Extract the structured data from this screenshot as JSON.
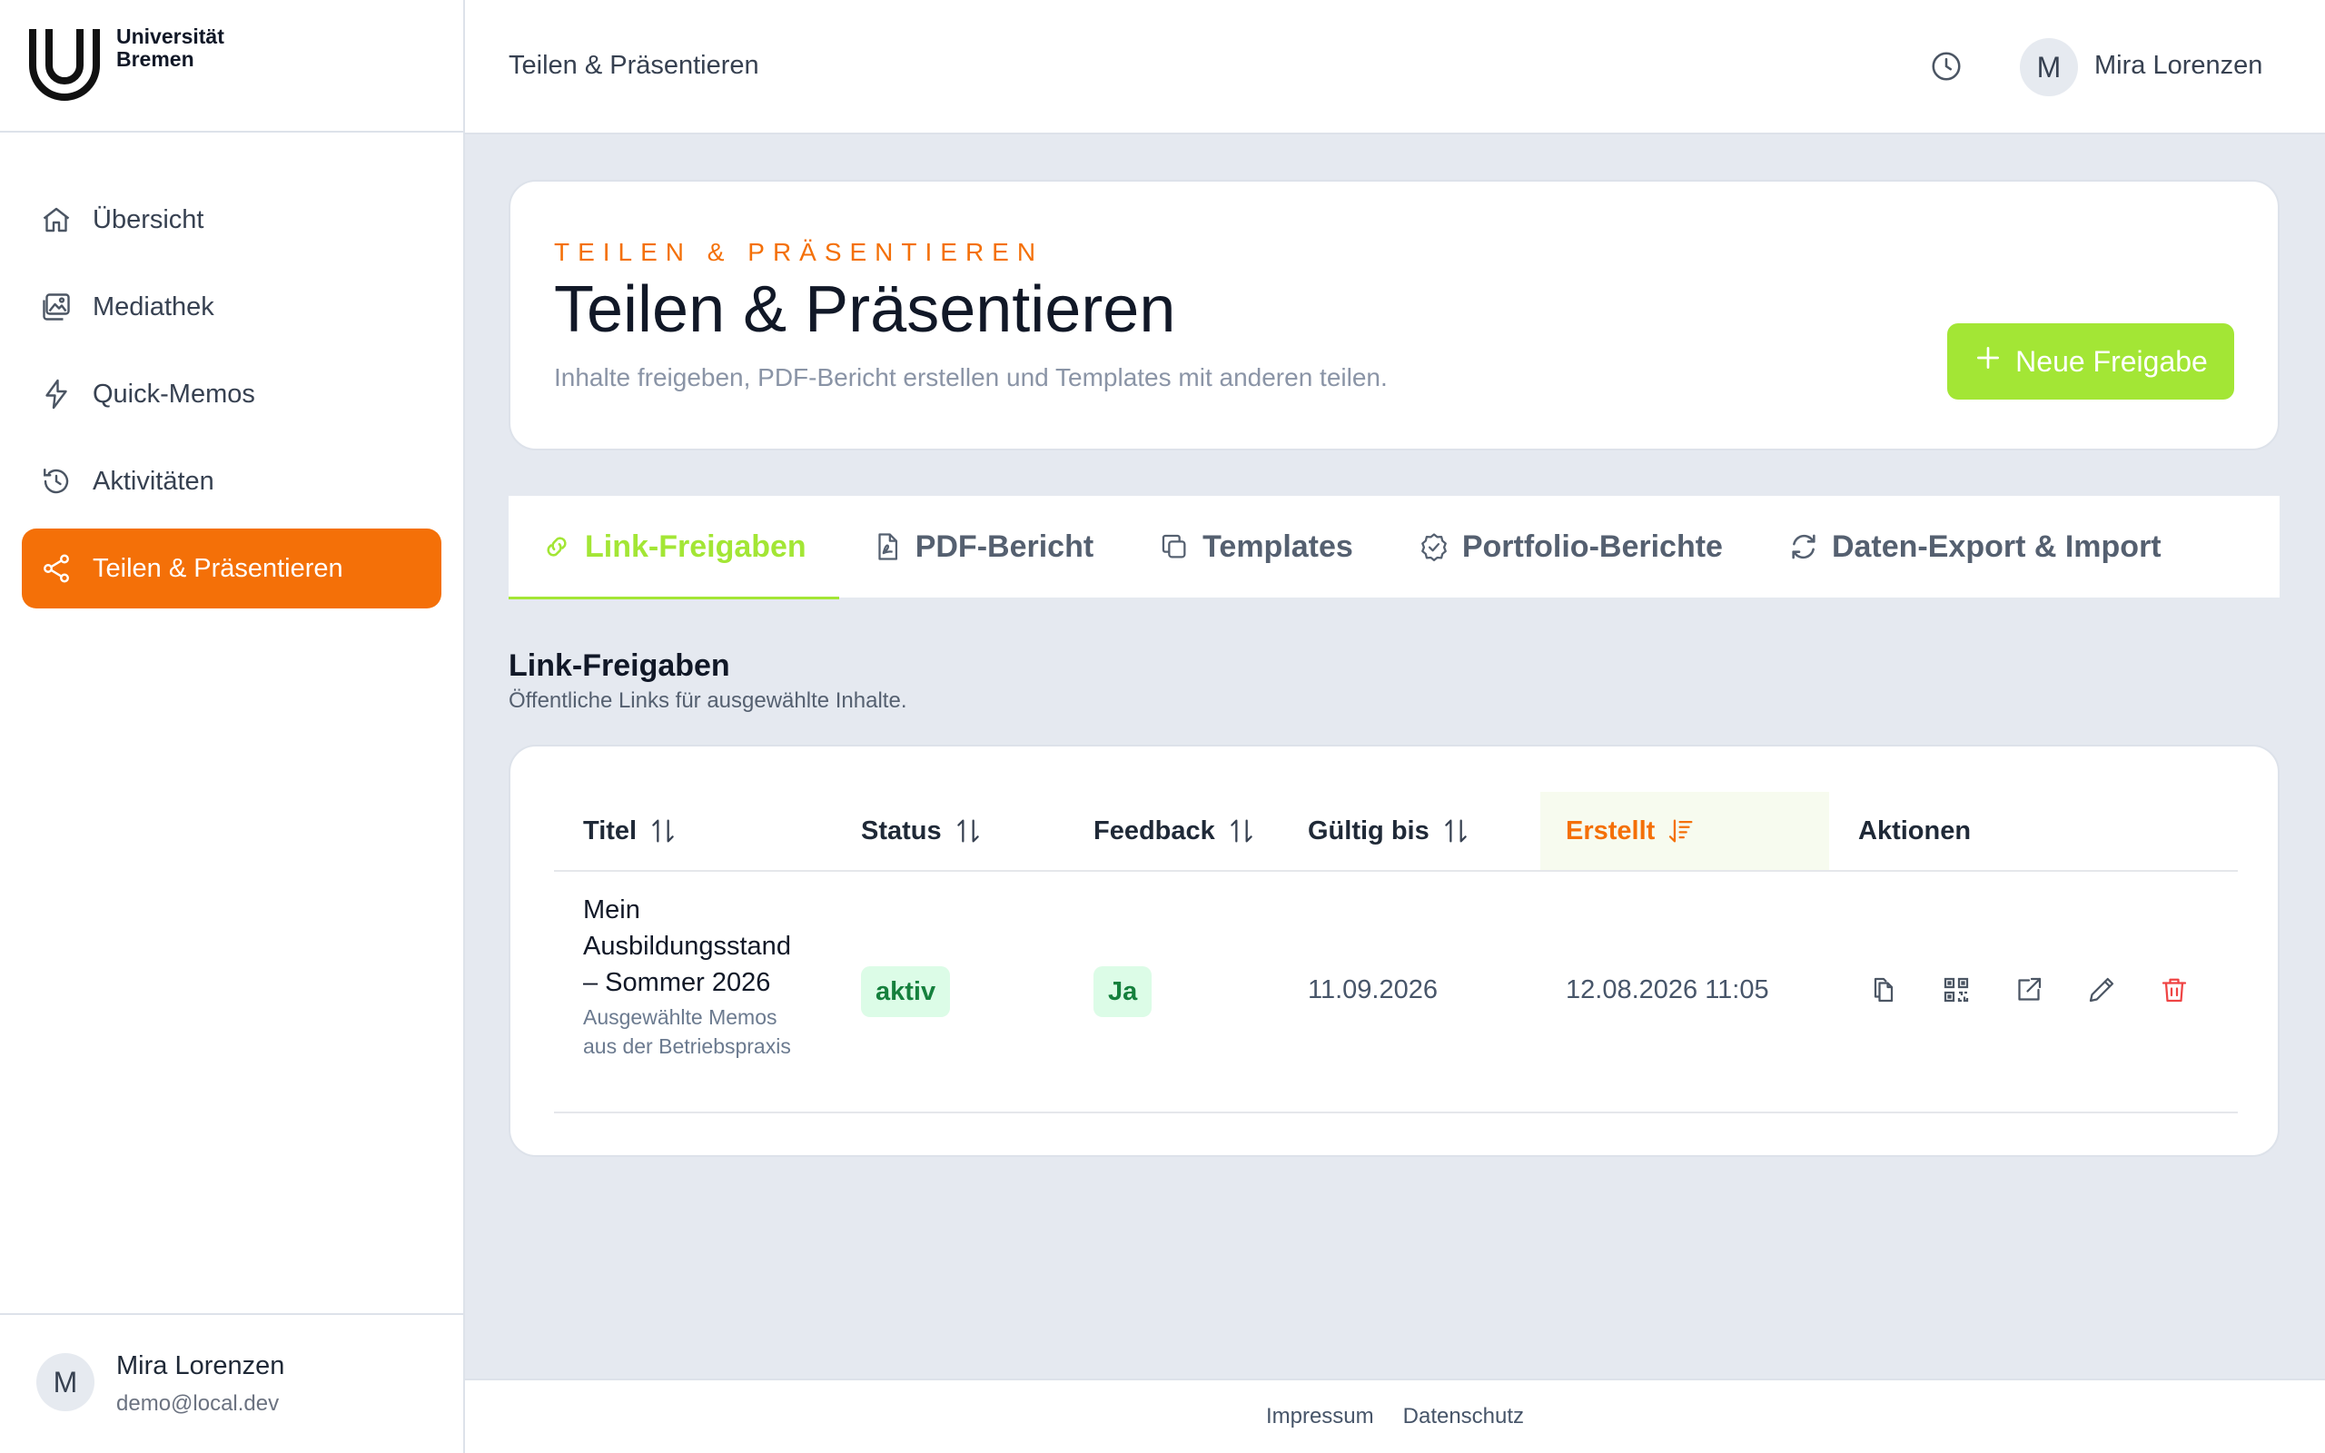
{
  "brand": {
    "line1": "Universität",
    "line2": "Bremen"
  },
  "sidebar": {
    "items": [
      {
        "label": "Übersicht",
        "icon": "home-icon"
      },
      {
        "label": "Mediathek",
        "icon": "images-icon"
      },
      {
        "label": "Quick-Memos",
        "icon": "lightning-icon"
      },
      {
        "label": "Aktivitäten",
        "icon": "history-icon"
      },
      {
        "label": "Teilen & Präsentieren",
        "icon": "share-icon",
        "active": true
      }
    ],
    "user": {
      "initial": "M",
      "name": "Mira Lorenzen",
      "email": "demo@local.dev"
    }
  },
  "header": {
    "title": "Teilen & Präsentieren",
    "user": {
      "initial": "M",
      "name": "Mira Lorenzen"
    }
  },
  "hero": {
    "eyebrow": "TEILEN & PRÄSENTIEREN",
    "title": "Teilen & Präsentieren",
    "subtitle": "Inhalte freigeben, PDF-Bericht erstellen und Templates mit anderen teilen.",
    "button": "Neue Freigabe"
  },
  "tabs": [
    {
      "label": "Link-Freigaben",
      "icon": "link-icon",
      "active": true
    },
    {
      "label": "PDF-Bericht",
      "icon": "pdf-file-icon"
    },
    {
      "label": "Templates",
      "icon": "copy-icon"
    },
    {
      "label": "Portfolio-Berichte",
      "icon": "check-badge-icon"
    },
    {
      "label": "Daten-Export & Import",
      "icon": "refresh-icon"
    }
  ],
  "section": {
    "title": "Link-Freigaben",
    "subtitle": "Öffentliche Links für ausgewählte Inhalte."
  },
  "table": {
    "columns": [
      "Titel",
      "Status",
      "Feedback",
      "Gültig bis",
      "Erstellt",
      "Aktionen"
    ],
    "sorted_column": "Erstellt",
    "rows": [
      {
        "title": "Mein Ausbildungsstand – Sommer 2026",
        "description": "Ausgewählte Memos aus der Betriebspraxis",
        "status": "aktiv",
        "feedback": "Ja",
        "valid_until": "11.09.2026",
        "created": "12.08.2026 11:05",
        "actions": [
          "copy-icon",
          "qr-code-icon",
          "external-link-icon",
          "edit-icon",
          "delete-icon"
        ]
      }
    ]
  },
  "footer": {
    "impressum": "Impressum",
    "datenschutz": "Datenschutz"
  },
  "colors": {
    "accent_orange": "#f47008",
    "accent_green": "#a3e635",
    "danger": "#ef4444"
  }
}
